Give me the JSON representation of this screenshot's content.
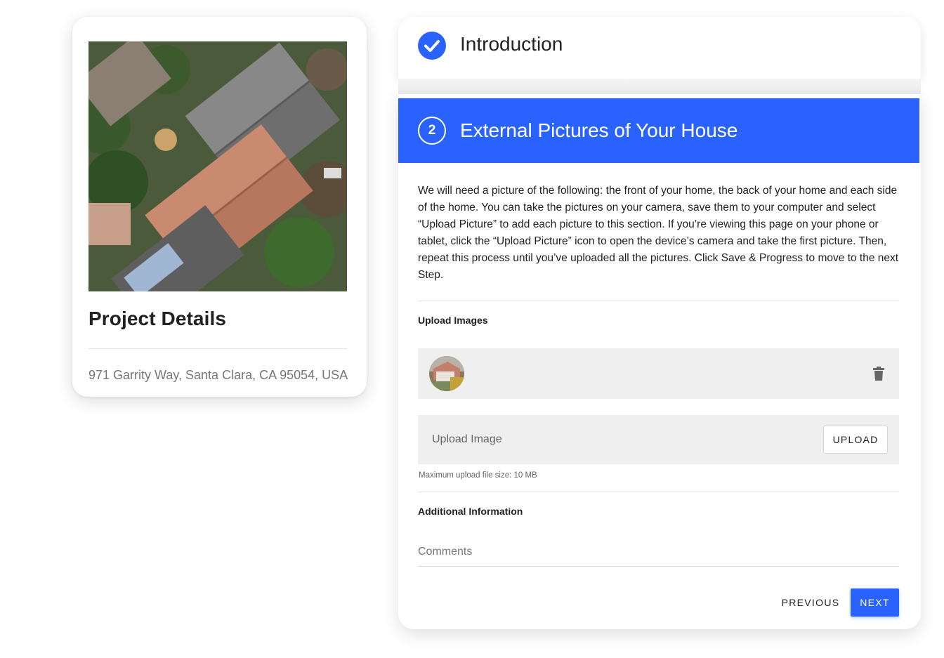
{
  "project": {
    "title": "Project Details",
    "address": "971 Garrity Way, Santa Clara, CA 95054, USA"
  },
  "steps": {
    "intro": {
      "title": "Introduction",
      "status": "complete"
    },
    "current": {
      "number": "2",
      "title": "External Pictures of Your House",
      "instructions": "We will need a picture of the following: the front of your home, the back of your home and each side of the home. You can take the pictures on your camera, save them to your computer and select “Upload Picture” to add each picture to this section. If you’re viewing this page on your phone or tablet, click the “Upload Picture” icon to open the device’s camera and take the first picture. Then, repeat this process until you’ve uploaded all the pictures. Click Save & Progress to move to the next Step."
    }
  },
  "upload": {
    "section_label": "Upload Images",
    "placeholder": "Upload Image",
    "button_label": "UPLOAD",
    "hint": "Maximum upload file size: 10 MB"
  },
  "additional": {
    "section_label": "Additional Information",
    "comments_placeholder": "Comments"
  },
  "nav": {
    "previous_label": "PREVIOUS",
    "next_label": "NEXT"
  },
  "colors": {
    "accent": "#2962ff",
    "field_bg": "#efefef"
  },
  "icons": [
    "check-icon",
    "trash-icon"
  ]
}
